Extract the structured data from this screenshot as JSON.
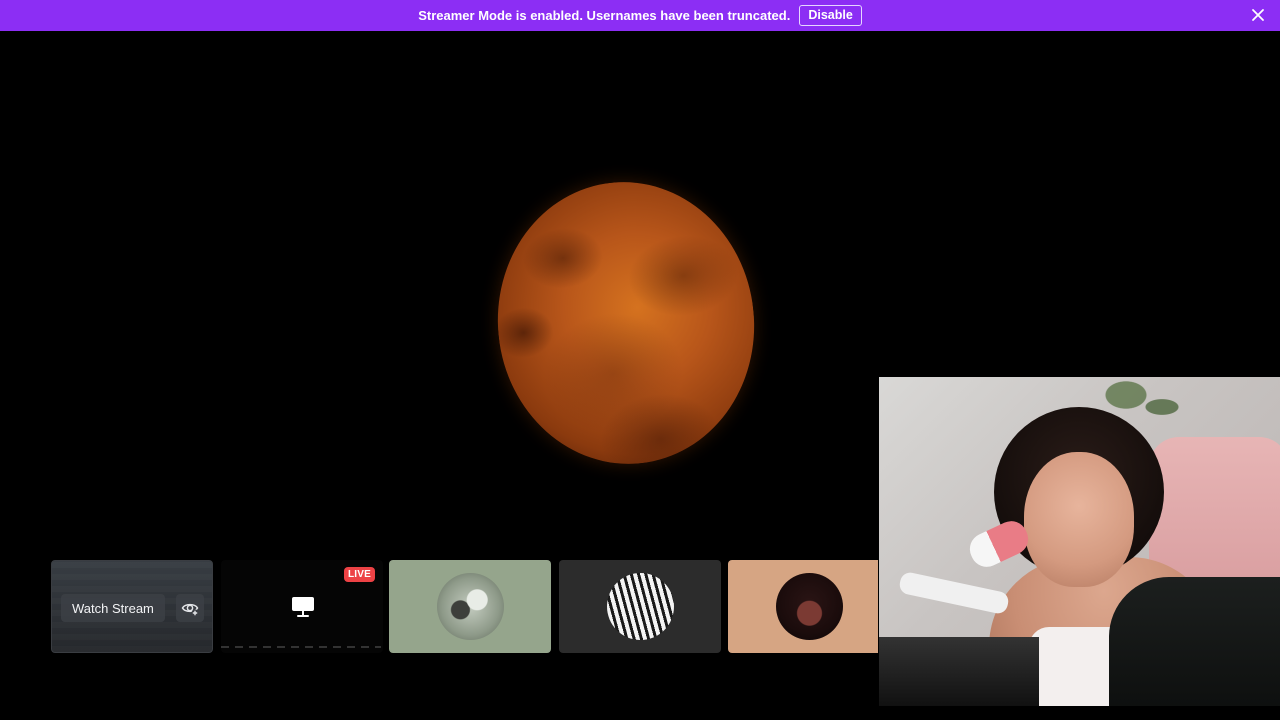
{
  "banner": {
    "message": "Streamer Mode is enabled. Usernames have been truncated.",
    "disable_label": "Disable",
    "close_icon": "close-icon",
    "background": "#8c2ef4"
  },
  "stage": {
    "content": "moon"
  },
  "tiles": [
    {
      "type": "stream",
      "watch_label": "Watch Stream",
      "icon": "eye-plus-icon"
    },
    {
      "type": "screen-share",
      "live_label": "LIVE",
      "icon": "monitor-icon",
      "live_color": "#ed4245"
    },
    {
      "type": "avatar",
      "background": "#95a58c"
    },
    {
      "type": "avatar",
      "background": "#2c2c2c"
    },
    {
      "type": "avatar",
      "background": "#d6a583"
    }
  ],
  "webcam": {
    "content": "streamer-webcam"
  }
}
